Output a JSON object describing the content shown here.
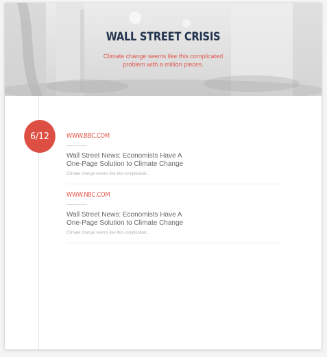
{
  "hero": {
    "title": "WALL STREET CRISIS",
    "subtitle_line1": "Climate change seems like this complicated",
    "subtitle_line2": "problem with a million pieces."
  },
  "timeline": {
    "date_badge": "6/12",
    "entries": [
      {
        "source": "WWW.BBC.COM",
        "title_line1": "Wall Street News: Economists Have A",
        "title_line2": "One-Page Solution to Climate Change",
        "excerpt": "Climate change seems like this complicated..."
      },
      {
        "source": "WWW.NBC.COM",
        "title_line1": "Wall Street News: Economists Have A",
        "title_line2": "One-Page Solution to Climate Change",
        "excerpt": "Climate change seems like this complicated..."
      }
    ]
  },
  "colors": {
    "accent": "#de4f43",
    "title": "#20324d",
    "body_text": "#666666"
  }
}
